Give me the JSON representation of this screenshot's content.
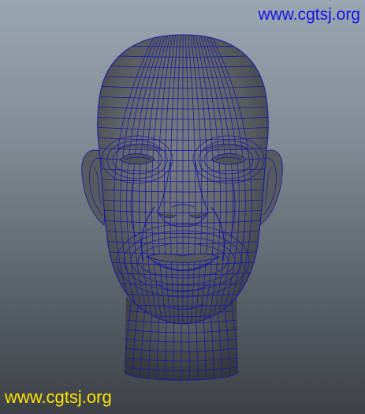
{
  "scene": {
    "model": "head-wireframe-mesh",
    "background_top": "#9aa6b1",
    "background_bottom": "#3c4146",
    "surface_color": "#6a6e72",
    "wireframe_color": "#1c1c9e"
  },
  "watermarks": {
    "top": {
      "text": "www.cgtsj.org",
      "color": "#1515e6"
    },
    "bottom": {
      "text": "www.cgtsj.org",
      "color": "#ffe100"
    }
  }
}
